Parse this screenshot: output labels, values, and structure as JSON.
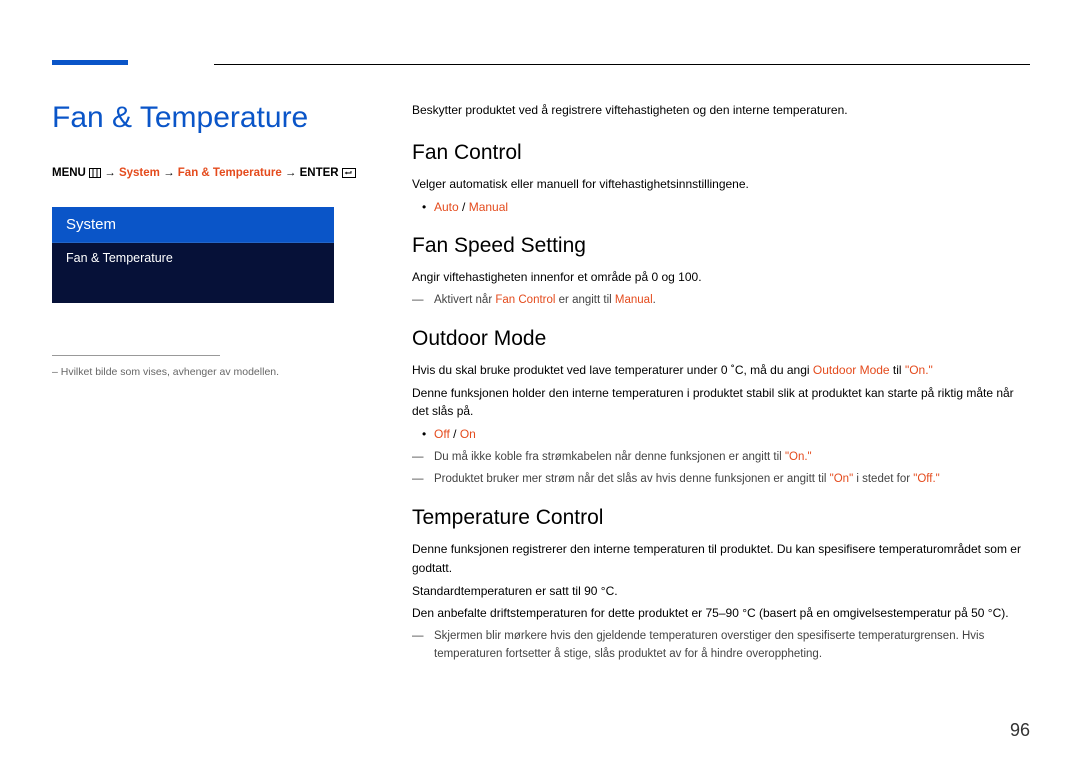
{
  "page_number": "96",
  "left": {
    "title": "Fan & Temperature",
    "breadcrumb": {
      "prefix": "MENU",
      "p1": "System",
      "p2": "Fan & Temperature",
      "suffix": "ENTER"
    },
    "menu_header": "System",
    "menu_item": "Fan & Temperature",
    "footnote_prefix": "–  ",
    "footnote": "Hvilket bilde som vises, avhenger av modellen."
  },
  "right": {
    "intro": "Beskytter produktet ved å registrere viftehastigheten og den interne temperaturen.",
    "fan_control": {
      "heading": "Fan Control",
      "desc": "Velger automatisk eller manuell for viftehastighetsinnstillingene.",
      "opt1": "Auto",
      "sep": " / ",
      "opt2": "Manual"
    },
    "fan_speed": {
      "heading": "Fan Speed Setting",
      "desc": "Angir viftehastigheten innenfor et område på 0 og 100.",
      "note_pre": "Aktivert når ",
      "note_hl1": "Fan Control",
      "note_mid": " er angitt til ",
      "note_hl2": "Manual",
      "note_end": "."
    },
    "outdoor": {
      "heading": "Outdoor Mode",
      "l1a": "Hvis du skal bruke produktet ved lave temperaturer under 0 ˚C, må du angi ",
      "l1b": "Outdoor Mode",
      "l1c": " til ",
      "l1d": "\"On.\"",
      "l2": "Denne funksjonen holder den interne temperaturen i produktet stabil slik at produktet kan starte på riktig måte når det slås på.",
      "opt1": "Off",
      "sep": " / ",
      "opt2": "On",
      "n1a": "Du må ikke koble fra strømkabelen når denne funksjonen er angitt til ",
      "n1b": "\"On.\"",
      "n2a": "Produktet bruker mer strøm når det slås av hvis denne funksjonen er angitt til ",
      "n2b": "\"On\"",
      "n2c": " i stedet for ",
      "n2d": "\"Off.\""
    },
    "temp": {
      "heading": "Temperature Control",
      "l1": "Denne funksjonen registrerer den interne temperaturen til produktet. Du kan spesifisere temperaturområdet som er godtatt.",
      "l2": "Standardtemperaturen er satt til 90 °C.",
      "l3": "Den anbefalte driftstemperaturen for dette produktet er 75–90 °C (basert på en omgivelsestemperatur på 50 °C).",
      "n1": "Skjermen blir mørkere hvis den gjeldende temperaturen overstiger den spesifiserte temperaturgrensen. Hvis temperaturen fortsetter å stige, slås produktet av for å hindre overoppheting."
    }
  }
}
